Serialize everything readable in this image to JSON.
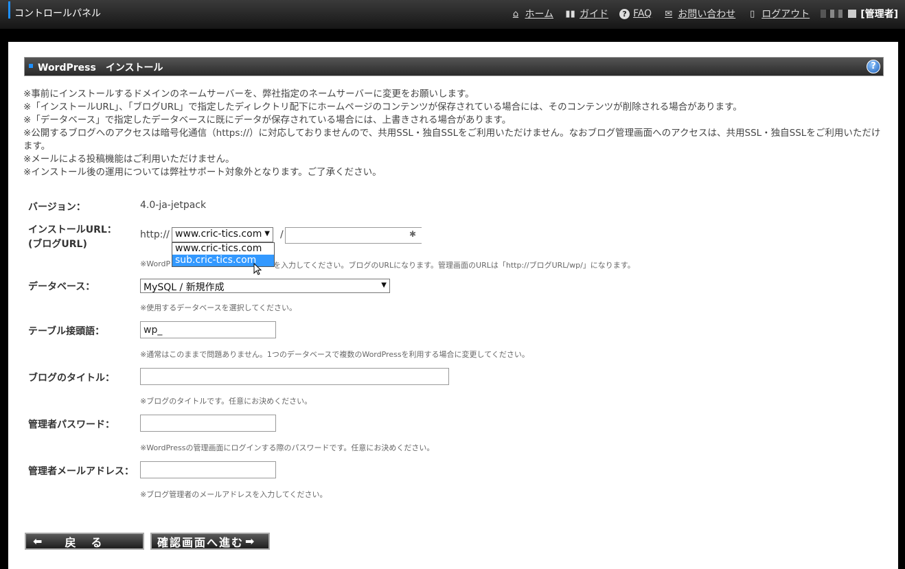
{
  "header": {
    "brand": "コントロールパネル",
    "nav": {
      "home": "ホーム",
      "guide": "ガイド",
      "faq": "FAQ",
      "contact": "お問い合わせ",
      "logout": "ログアウト",
      "role": "[管理者]"
    }
  },
  "section": {
    "title": "WordPress　インストール",
    "help": "?"
  },
  "notes": [
    "※事前にインストールするドメインのネームサーバーを、弊社指定のネームサーバーに変更をお願いします。",
    "※「インストールURL」、「ブログURL」で指定したディレクトリ配下にホームページのコンテンツが保存されている場合には、そのコンテンツが削除される場合があります。",
    "※「データベース」で指定したデータベースに既にデータが保存されている場合には、上書きされる場合があります。",
    "※公開するブログへのアクセスは暗号化通信（https://）に対応しておりませんので、共用SSL・独自SSLをご利用いただけません。なおブログ管理画面へのアクセスは、共用SSL・独自SSLをご利用いただけます。",
    "※メールによる投稿機能はご利用いただけません。",
    "※インストール後の運用については弊社サポート対象外となります。ご了承ください。"
  ],
  "form": {
    "version": {
      "label": "バージョン：",
      "value": "4.0-ja-jetpack"
    },
    "install_url": {
      "label_line1": "インストールURL：",
      "label_line2": "(ブログURL)",
      "prefix": "http://",
      "domain_selected": "www.cric-tics.com",
      "domain_options": [
        "www.cric-tics.com",
        "sub.cric-tics.com"
      ],
      "highlighted_option": "sub.cric-tics.com",
      "slash": "/",
      "path_value": "",
      "hint_visible_start": "※WordP",
      "hint_visible_end": "を入力してください。ブログのURLになります。管理画面のURLは「http://ブログURL/wp/」になります。"
    },
    "database": {
      "label": "データベース：",
      "selected": "MySQL / 新規作成",
      "hint": "※使用するデータベースを選択してください。"
    },
    "table_prefix": {
      "label": "テーブル接頭語：",
      "value": "wp_",
      "hint": "※通常はこのままで問題ありません。1つのデータベースで複数のWordPressを利用する場合に変更してください。"
    },
    "blog_title": {
      "label": "ブログのタイトル：",
      "value": "",
      "hint": "※ブログのタイトルです。任意にお決めください。"
    },
    "admin_password": {
      "label": "管理者パスワード：",
      "value": "",
      "hint": "※WordPressの管理画面にログインする際のパスワードです。任意にお決めください。"
    },
    "admin_email": {
      "label": "管理者メールアドレス：",
      "value": "",
      "hint": "※ブログ管理者のメールアドレスを入力してください。"
    }
  },
  "buttons": {
    "back": "戻　る",
    "confirm": "確認画面へ進む"
  }
}
